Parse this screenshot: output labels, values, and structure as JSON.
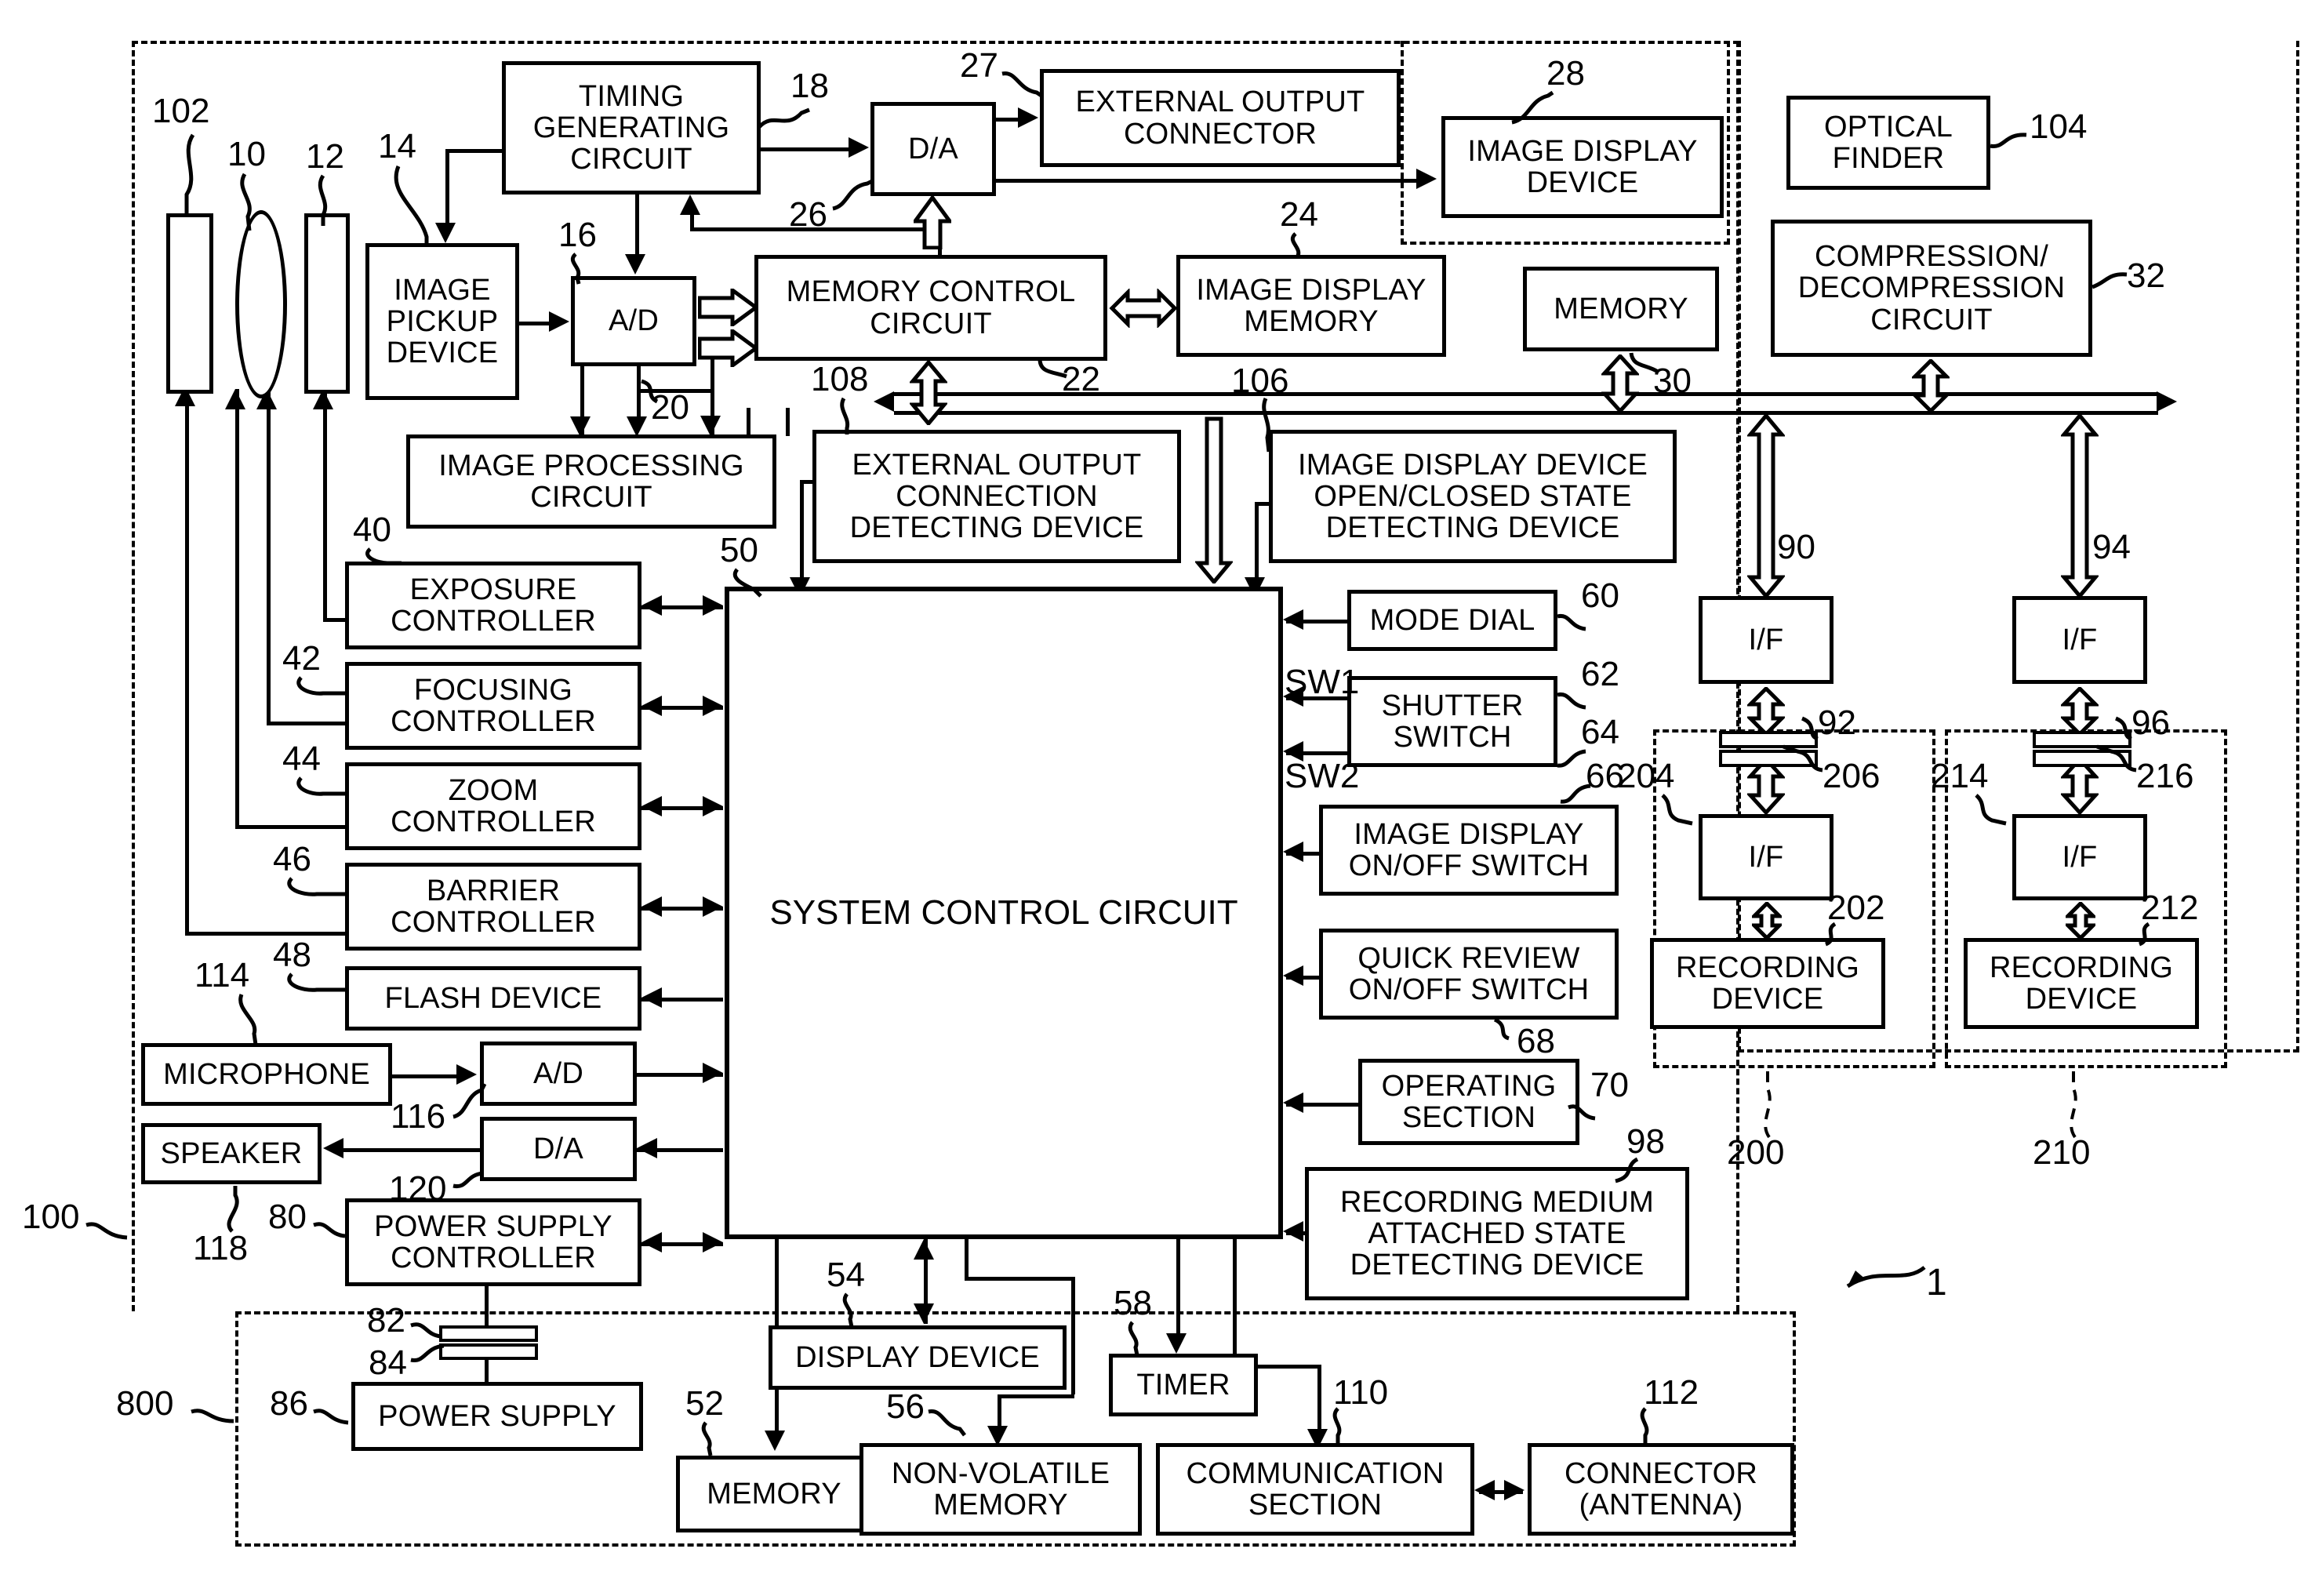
{
  "figure": {
    "type": "patent-block-diagram",
    "figure_reference": "1"
  },
  "blocks": {
    "timing_generating_circuit": "TIMING\nGENERATING\nCIRCUIT",
    "da_top": "D/A",
    "external_output_connector": "EXTERNAL OUTPUT\nCONNECTOR",
    "image_display_device": "IMAGE DISPLAY\nDEVICE",
    "optical_finder": "OPTICAL\nFINDER",
    "compression_decompression_circuit": "COMPRESSION/\nDECOMPRESSION\nCIRCUIT",
    "image_pickup_device": "IMAGE\nPICKUP\nDEVICE",
    "ad_top": "A/D",
    "memory_control_circuit": "MEMORY CONTROL\nCIRCUIT",
    "image_display_memory": "IMAGE DISPLAY\nMEMORY",
    "memory_30": "MEMORY",
    "image_processing_circuit": "IMAGE PROCESSING\nCIRCUIT",
    "external_output_connection_detecting_device": "EXTERNAL OUTPUT\nCONNECTION\nDETECTING DEVICE",
    "image_display_device_open_closed_state_detecting_device": "IMAGE DISPLAY DEVICE\nOPEN/CLOSED STATE\nDETECTING DEVICE",
    "exposure_controller": "EXPOSURE\nCONTROLLER",
    "focusing_controller": "FOCUSING\nCONTROLLER",
    "zoom_controller": "ZOOM\nCONTROLLER",
    "barrier_controller": "BARRIER\nCONTROLLER",
    "flash_device": "FLASH DEVICE",
    "microphone": "MICROPHONE",
    "speaker": "SPEAKER",
    "ad_audio": "A/D",
    "da_audio": "D/A",
    "power_supply_controller": "POWER SUPPLY\nCONTROLLER",
    "power_supply": "POWER SUPPLY",
    "system_control_circuit": "SYSTEM CONTROL CIRCUIT",
    "mode_dial": "MODE DIAL",
    "shutter_switch": "SHUTTER\nSWITCH",
    "image_display_on_off_switch": "IMAGE DISPLAY\nON/OFF SWITCH",
    "quick_review_on_off_switch": "QUICK REVIEW\nON/OFF SWITCH",
    "operating_section": "OPERATING\nSECTION",
    "recording_medium_attached_state_detecting_device": "RECORDING MEDIUM\nATTACHED STATE\nDETECTING DEVICE",
    "display_device": "DISPLAY DEVICE",
    "timer": "TIMER",
    "memory_52": "MEMORY",
    "non_volatile_memory": "NON-VOLATILE\nMEMORY",
    "communication_section": "COMMUNICATION\nSECTION",
    "connector_antenna": "CONNECTOR\n(ANTENNA)",
    "if_90": "I/F",
    "if_94": "I/F",
    "if_204": "I/F",
    "if_214": "I/F",
    "recording_device_left": "RECORDING\nDEVICE",
    "recording_device_right": "RECORDING\nDEVICE"
  },
  "signal_labels": {
    "sw1": "SW1",
    "sw2": "SW2"
  },
  "reference_numerals": {
    "n102": "102",
    "n10": "10",
    "n12": "12",
    "n14": "14",
    "n16": "16",
    "n18": "18",
    "n20": "20",
    "n22": "22",
    "n24": "24",
    "n26": "26",
    "n27": "27",
    "n28": "28",
    "n30": "30",
    "n32": "32",
    "n40": "40",
    "n42": "42",
    "n44": "44",
    "n46": "46",
    "n48": "48",
    "n50": "50",
    "n52": "52",
    "n54": "54",
    "n56": "56",
    "n58": "58",
    "n60": "60",
    "n62": "62",
    "n64": "64",
    "n66": "66",
    "n68": "68",
    "n70": "70",
    "n80": "80",
    "n82": "82",
    "n84": "84",
    "n86": "86",
    "n90": "90",
    "n92": "92",
    "n94": "94",
    "n96": "96",
    "n98": "98",
    "n100": "100",
    "n104": "104",
    "n106": "106",
    "n108": "108",
    "n110": "110",
    "n112": "112",
    "n114": "114",
    "n116": "116",
    "n118": "118",
    "n120": "120",
    "n200": "200",
    "n202": "202",
    "n204": "204",
    "n206": "206",
    "n210": "210",
    "n212": "212",
    "n214": "214",
    "n216": "216",
    "n800": "800",
    "n1": "1"
  },
  "colors": {
    "ink": "#000000",
    "paper": "#ffffff"
  }
}
